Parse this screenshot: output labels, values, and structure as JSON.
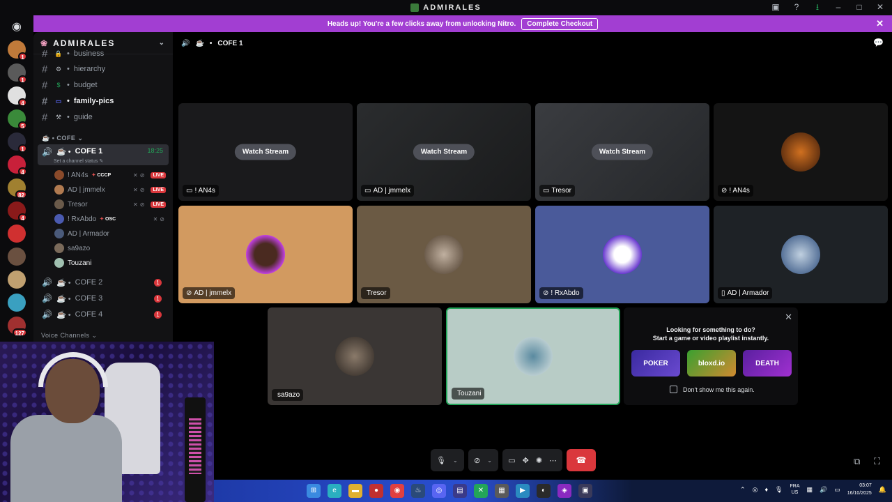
{
  "window": {
    "title": "ADMIRALES"
  },
  "banner": {
    "text": "Heads up! You're a few clicks away from unlocking Nitro.",
    "cta": "Complete Checkout"
  },
  "servers": [
    {
      "badge": "1",
      "color": "#c07a3a"
    },
    {
      "badge": "1",
      "color": "#5a5a5a"
    },
    {
      "badge": "4",
      "color": "#e0e0e0"
    },
    {
      "badge": "5",
      "color": "#3a8a3a"
    },
    {
      "badge": "1",
      "color": "#2a2a3a"
    },
    {
      "badge": "4",
      "color": "#c8203a"
    },
    {
      "badge": "82",
      "color": "#a08030"
    },
    {
      "badge": "4",
      "color": "#8a1a1a"
    },
    {
      "badge": "",
      "color": "#d03030"
    },
    {
      "badge": "",
      "color": "#6a5040"
    },
    {
      "badge": "",
      "color": "#c0a070"
    },
    {
      "badge": "",
      "color": "#3aa0c0"
    },
    {
      "badge": "127",
      "color": "#a03030"
    }
  ],
  "sidebar": {
    "guild_name": "ADMIRALES",
    "text_channels": [
      {
        "name": "business",
        "emoji": "🔒"
      },
      {
        "name": "hierarchy",
        "emoji": "⚙"
      },
      {
        "name": "budget",
        "emoji": "$"
      },
      {
        "name": "family-pics",
        "emoji": "▭"
      },
      {
        "name": "guide",
        "emoji": "⚒"
      }
    ],
    "category": "COFE",
    "voice_selected": {
      "name": "COFE 1",
      "time": "18:25",
      "status_placeholder": "Set a channel status"
    },
    "voice_users": [
      {
        "name": "! AN4s",
        "tag": "CCCP",
        "live": "LIVE"
      },
      {
        "name": "AD | jmmelx",
        "tag": "",
        "live": "LIVE"
      },
      {
        "name": "Tresor",
        "tag": "",
        "live": "LIVE"
      },
      {
        "name": "! RxAbdo",
        "tag": "OSC",
        "live": ""
      },
      {
        "name": "AD | Armador",
        "tag": "",
        "live": ""
      },
      {
        "name": "sa9azo",
        "tag": "",
        "live": ""
      },
      {
        "name": "Touzani",
        "tag": "",
        "live": ""
      }
    ],
    "other_voice": [
      {
        "name": "COFE 2",
        "badge": "1"
      },
      {
        "name": "COFE 3",
        "badge": "1"
      },
      {
        "name": "COFE 4",
        "badge": "1"
      }
    ],
    "voice_category": "Voice Channels"
  },
  "header": {
    "channel": "COFE 1"
  },
  "tiles": {
    "watch_label": "Watch Stream",
    "streams": [
      "! AN4s",
      "AD | jmmelx",
      "Tresor"
    ],
    "an4s_cam": "! AN4s",
    "row2": [
      "AD | jmmelx",
      "Tresor",
      "! RxAbdo",
      "AD | Armador"
    ],
    "row3": [
      "sa9azo",
      "Touzani"
    ]
  },
  "promo": {
    "line1": "Looking for something to do?",
    "line2": "Start a game or video playlist instantly.",
    "games": [
      "POKER",
      "bloxd.io",
      "DEATH"
    ],
    "dont_show": "Don't show me this again."
  },
  "taskbar": {
    "lang": "FRA",
    "region": "US",
    "time": "03:07",
    "date": "16/10/2025"
  }
}
